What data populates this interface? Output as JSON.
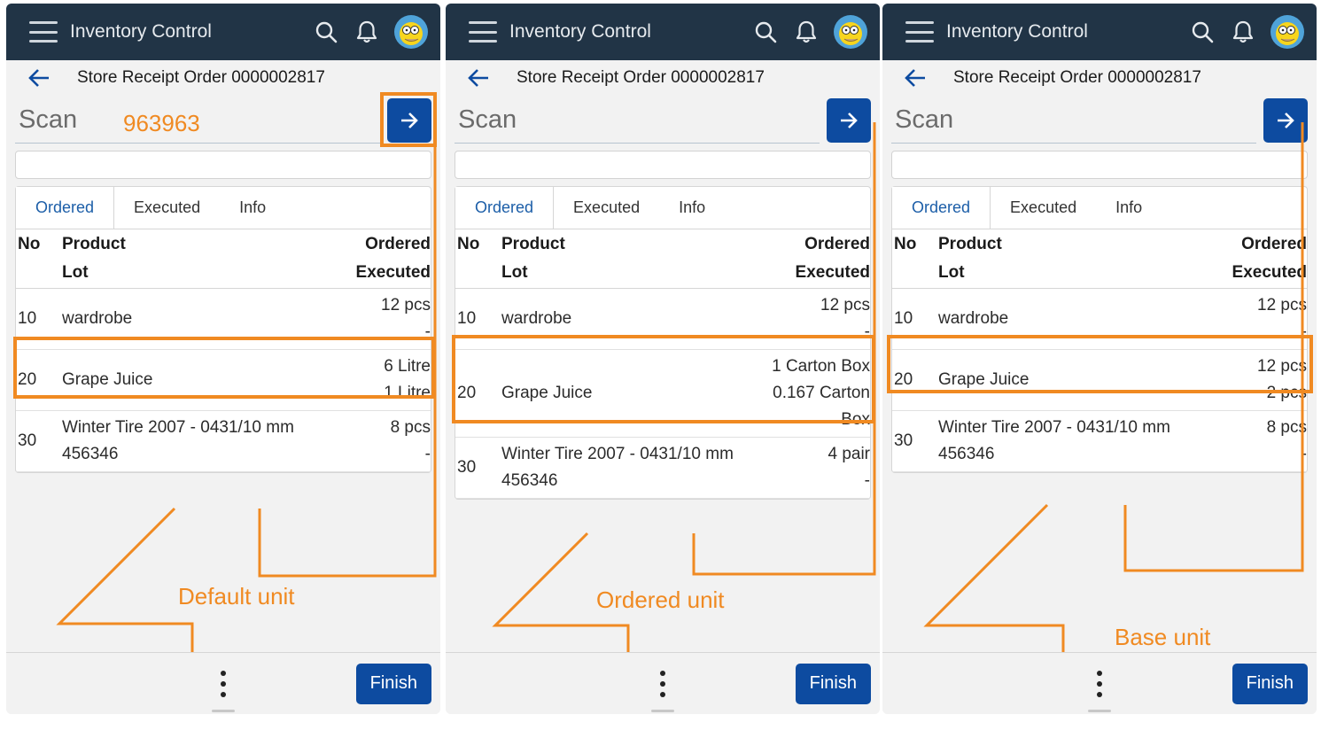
{
  "app": {
    "title": "Inventory Control",
    "icons": [
      "menu-icon",
      "search-icon",
      "bell-icon",
      "avatar"
    ]
  },
  "colors": {
    "appbar": "#213446",
    "primary": "#0d4ba0",
    "annotation": "#f08a22",
    "active_tab": "#1c5ea8"
  },
  "screens": [
    {
      "order_title": "Store Receipt Order 0000002817",
      "scan_placeholder": "Scan",
      "scan_typed": "963963",
      "tabs": [
        "Ordered",
        "Executed",
        "Info"
      ],
      "active_tab": "Ordered",
      "header": {
        "no": "No",
        "product": "Product",
        "lot": "Lot",
        "ordered": "Ordered",
        "executed": "Executed"
      },
      "rows": [
        {
          "no": "10",
          "product": "wardrobe",
          "lot": "",
          "ordered": "12 pcs",
          "executed": "-"
        },
        {
          "no": "20",
          "product": "Grape Juice",
          "lot": "",
          "ordered": "6 Litre",
          "executed": "1 Litre"
        },
        {
          "no": "30",
          "product": "Winter Tire 2007 - 0431/10 mm",
          "lot": "456346",
          "ordered": "8 pcs",
          "executed": "-"
        }
      ],
      "caption": "Default unit",
      "finish_label": "Finish"
    },
    {
      "order_title": "Store Receipt Order 0000002817",
      "scan_placeholder": "Scan",
      "scan_typed": "",
      "tabs": [
        "Ordered",
        "Executed",
        "Info"
      ],
      "active_tab": "Ordered",
      "header": {
        "no": "No",
        "product": "Product",
        "lot": "Lot",
        "ordered": "Ordered",
        "executed": "Executed"
      },
      "rows": [
        {
          "no": "10",
          "product": "wardrobe",
          "lot": "",
          "ordered": "12 pcs",
          "executed": "-"
        },
        {
          "no": "20",
          "product": "Grape Juice",
          "lot": "",
          "ordered": "1 Carton Box",
          "executed_line1": "0.167 Carton",
          "executed_line2": "Box"
        },
        {
          "no": "30",
          "product": "Winter Tire 2007 - 0431/10 mm",
          "lot": "456346",
          "ordered": "4 pair",
          "executed": "-"
        }
      ],
      "caption": "Ordered unit",
      "finish_label": "Finish"
    },
    {
      "order_title": "Store Receipt Order 0000002817",
      "scan_placeholder": "Scan",
      "scan_typed": "",
      "tabs": [
        "Ordered",
        "Executed",
        "Info"
      ],
      "active_tab": "Ordered",
      "header": {
        "no": "No",
        "product": "Product",
        "lot": "Lot",
        "ordered": "Ordered",
        "executed": "Executed"
      },
      "rows": [
        {
          "no": "10",
          "product": "wardrobe",
          "lot": "",
          "ordered": "12 pcs",
          "executed": "-"
        },
        {
          "no": "20",
          "product": "Grape Juice",
          "lot": "",
          "ordered": "12 pcs",
          "executed": "2 pcs"
        },
        {
          "no": "30",
          "product": "Winter Tire 2007 - 0431/10 mm",
          "lot": "456346",
          "ordered": "8 pcs",
          "executed": "-"
        }
      ],
      "caption": "Base unit",
      "finish_label": "Finish"
    }
  ]
}
